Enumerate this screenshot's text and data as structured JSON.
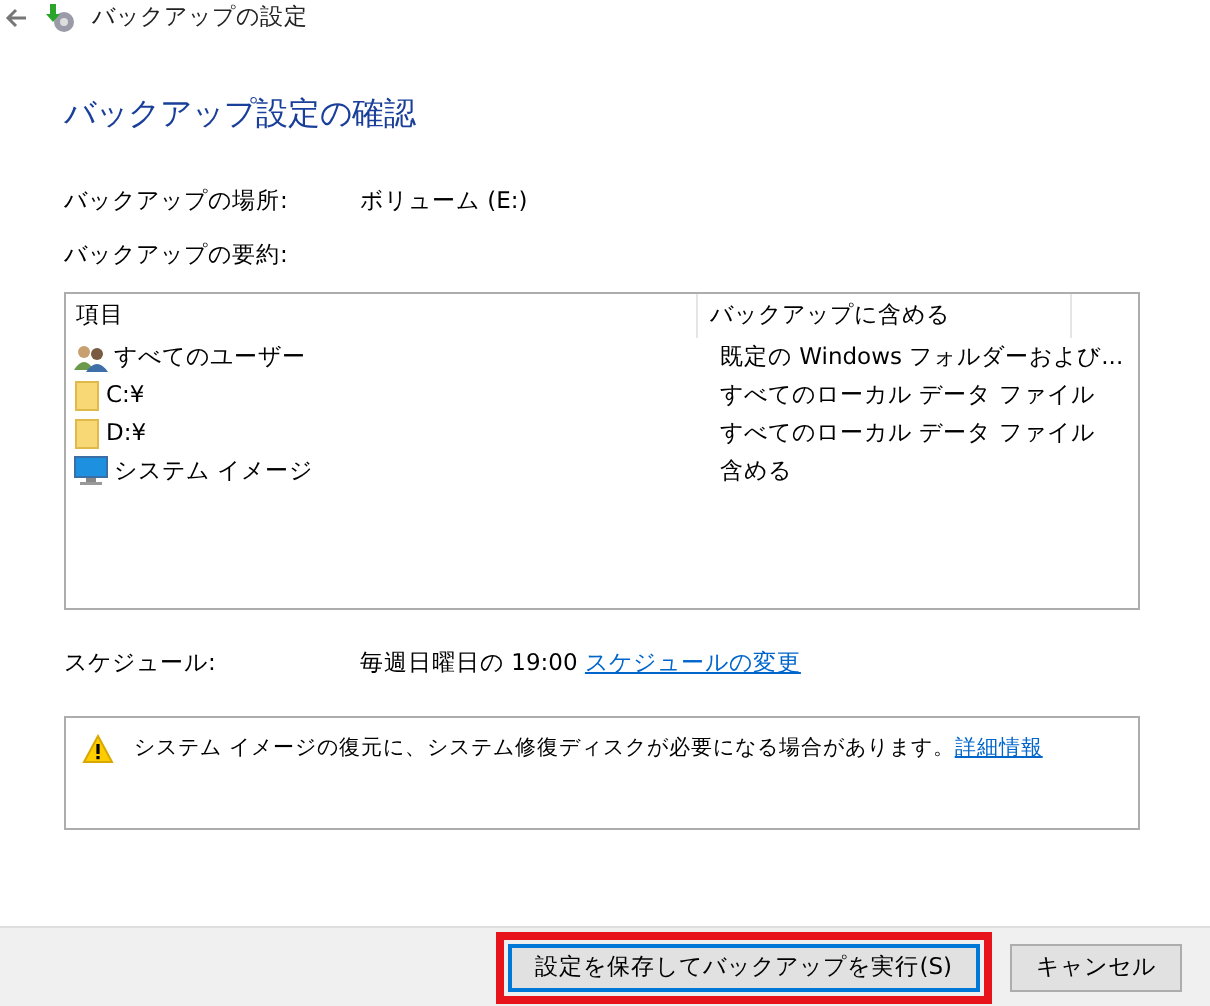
{
  "window": {
    "title": "バックアップの設定"
  },
  "heading": "バックアップ設定の確認",
  "location": {
    "label": "バックアップの場所:",
    "value": "ボリューム (E:)"
  },
  "summary_label": "バックアップの要約:",
  "table": {
    "columns": [
      "項目",
      "バックアップに含める"
    ],
    "rows": [
      {
        "kind": "users",
        "item": "すべてのユーザー",
        "included": "既定の Windows フォルダーおよび..."
      },
      {
        "kind": "folder",
        "item": "C:¥",
        "included": "すべてのローカル データ ファイル"
      },
      {
        "kind": "folder",
        "item": "D:¥",
        "included": "すべてのローカル データ ファイル"
      },
      {
        "kind": "monitor",
        "item": "システム イメージ",
        "included": "含める"
      }
    ]
  },
  "schedule": {
    "label": "スケジュール:",
    "value": "毎週日曜日の 19:00",
    "link": "スケジュールの変更"
  },
  "warning": {
    "text": "システム イメージの復元に、システム修復ディスクが必要になる場合があります。",
    "link": "詳細情報"
  },
  "buttons": [
    {
      "label": "設定を保存してバックアップを実行(S)",
      "primary": true,
      "highlighted": true
    },
    {
      "label": "キャンセル",
      "primary": false,
      "highlighted": false
    }
  ]
}
